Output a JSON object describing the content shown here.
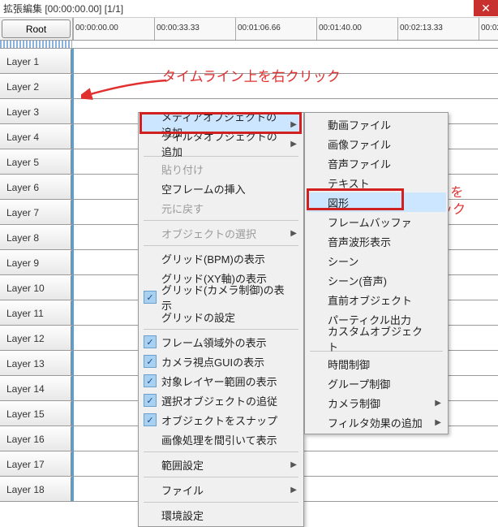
{
  "window": {
    "title": "拡張編集 [00:00:00.00] [1/1]"
  },
  "toolbar": {
    "root_label": "Root"
  },
  "ruler": {
    "ticks": [
      "00:00:00.00",
      "00:00:33.33",
      "00:01:06.66",
      "00:01:40.00",
      "00:02:13.33",
      "00:02"
    ]
  },
  "layers": [
    {
      "label": "Layer 1"
    },
    {
      "label": "Layer 2"
    },
    {
      "label": "Layer 3"
    },
    {
      "label": "Layer 4"
    },
    {
      "label": "Layer 5"
    },
    {
      "label": "Layer 6"
    },
    {
      "label": "Layer 7"
    },
    {
      "label": "Layer 8"
    },
    {
      "label": "Layer 9"
    },
    {
      "label": "Layer 10"
    },
    {
      "label": "Layer 11"
    },
    {
      "label": "Layer 12"
    },
    {
      "label": "Layer 13"
    },
    {
      "label": "Layer 14"
    },
    {
      "label": "Layer 15"
    },
    {
      "label": "Layer 16"
    },
    {
      "label": "Layer 17"
    },
    {
      "label": "Layer 18"
    }
  ],
  "context_menu": {
    "items": [
      {
        "label": "メディアオブジェクトの追加",
        "submenu": true,
        "highlight": true
      },
      {
        "label": "フィルタオブジェクトの追加",
        "submenu": true
      },
      {
        "sep": true
      },
      {
        "label": "貼り付け",
        "disabled": true
      },
      {
        "label": "空フレームの挿入"
      },
      {
        "label": "元に戻す",
        "disabled": true
      },
      {
        "sep": true
      },
      {
        "label": "オブジェクトの選択",
        "submenu": true,
        "disabled": true
      },
      {
        "sep": true
      },
      {
        "label": "グリッド(BPM)の表示"
      },
      {
        "label": "グリッド(XY軸)の表示"
      },
      {
        "label": "グリッド(カメラ制御)の表示",
        "checked": true
      },
      {
        "label": "グリッドの設定"
      },
      {
        "sep": true
      },
      {
        "label": "フレーム領域外の表示",
        "checked": true
      },
      {
        "label": "カメラ視点GUIの表示",
        "checked": true
      },
      {
        "label": "対象レイヤー範囲の表示",
        "checked": true
      },
      {
        "label": "選択オブジェクトの追従",
        "checked": true
      },
      {
        "label": "オブジェクトをスナップ",
        "checked": true
      },
      {
        "label": "画像処理を間引いて表示"
      },
      {
        "sep": true
      },
      {
        "label": "範囲設定",
        "submenu": true
      },
      {
        "sep": true
      },
      {
        "label": "ファイル",
        "submenu": true
      },
      {
        "sep": true
      },
      {
        "label": "環境設定"
      }
    ]
  },
  "submenu": {
    "items": [
      {
        "label": "動画ファイル"
      },
      {
        "label": "画像ファイル"
      },
      {
        "label": "音声ファイル"
      },
      {
        "label": "テキスト"
      },
      {
        "label": "図形",
        "highlight": true
      },
      {
        "label": "フレームバッファ"
      },
      {
        "label": "音声波形表示"
      },
      {
        "label": "シーン"
      },
      {
        "label": "シーン(音声)"
      },
      {
        "label": "直前オブジェクト"
      },
      {
        "label": "パーティクル出力"
      },
      {
        "label": "カスタムオブジェクト"
      },
      {
        "sep": true
      },
      {
        "label": "時間制御"
      },
      {
        "label": "グループ制御"
      },
      {
        "label": "カメラ制御",
        "submenu": true
      },
      {
        "label": "フィルタ効果の追加",
        "submenu": true
      }
    ]
  },
  "annotations": {
    "rightclick": "タイムライン上を右クリック",
    "shape_click": "[図形] を\nクリック"
  }
}
